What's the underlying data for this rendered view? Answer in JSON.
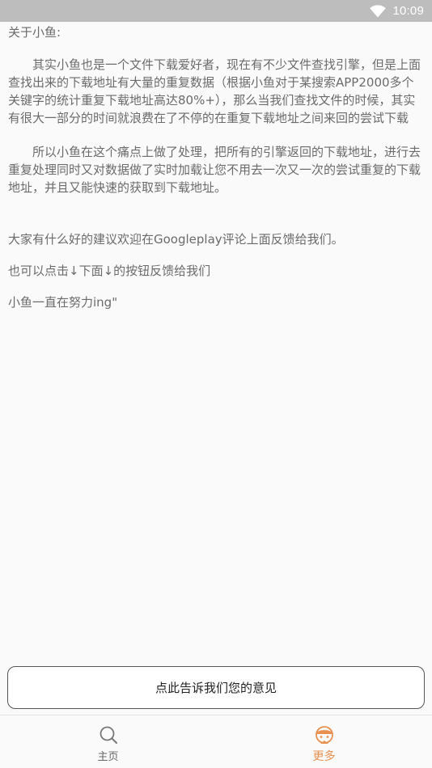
{
  "status_bar": {
    "time": "10:09",
    "wifi_icon": "wifi-icon"
  },
  "about": {
    "title": "关于小鱼:",
    "paragraphs": [
      "其实小鱼也是一个文件下载爱好者，现在有不少文件查找引擎，但是上面查找出来的下载地址有大量的重复数据（根据小鱼对于某搜索APP2000多个关键字的统计重复下载地址高达80%+），那么当我们查找文件的时候，其实有很大一部分的时间就浪费在了不停的在重复下载地址之间来回的尝试下载",
      "所以小鱼在这个痛点上做了处理，把所有的引擎返回的下载地址，进行去重复处理同时又对数据做了实时加载让您不用去一次又一次的尝试重复的下载地址，并且又能快速的获取到下载地址。",
      "大家有什么好的建议欢迎在Googleplay评论上面反馈给我们。",
      "也可以点击↓下面↓的按钮反馈给我们",
      "小鱼一直在努力ing\""
    ]
  },
  "feedback_button": {
    "label": "点此告诉我们您的意见"
  },
  "bottom_nav": {
    "items": [
      {
        "label": "主页",
        "icon": "search-icon"
      },
      {
        "label": "更多",
        "icon": "fish-icon"
      }
    ],
    "active_color": "#e8904f",
    "inactive_color": "#666666"
  }
}
